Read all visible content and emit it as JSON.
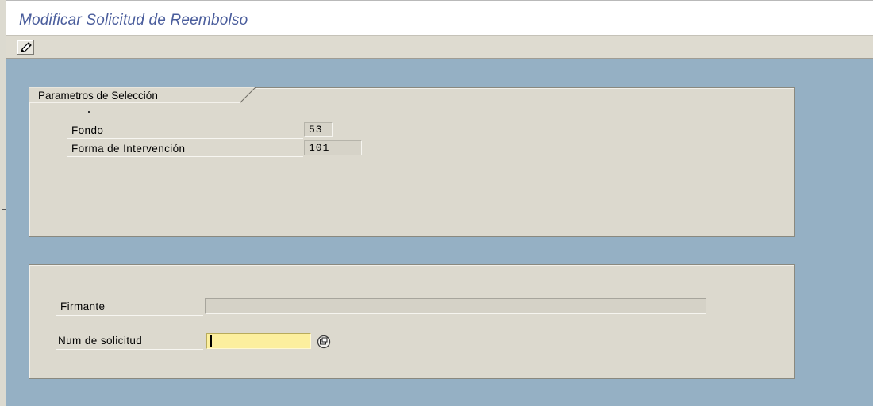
{
  "window": {
    "title": "Modificar Solicitud de Reembolso"
  },
  "toolbar": {
    "icons": [
      "pencil-icon",
      "value-help-icon"
    ]
  },
  "selection_group": {
    "title": "Parametros de Selección",
    "fields": [
      {
        "label": "Fondo",
        "value": "53"
      },
      {
        "label": "Forma de Intervención",
        "value": "101"
      }
    ]
  },
  "request_group": {
    "firmante": {
      "label": "Firmante",
      "value": ""
    },
    "num_solicitud": {
      "label": "Num de solicitud",
      "value": ""
    }
  },
  "colors": {
    "background": "#95b0c4",
    "panel": "#dcd9ce",
    "title": "#4a5d9c",
    "required_input": "#fcef9e"
  }
}
